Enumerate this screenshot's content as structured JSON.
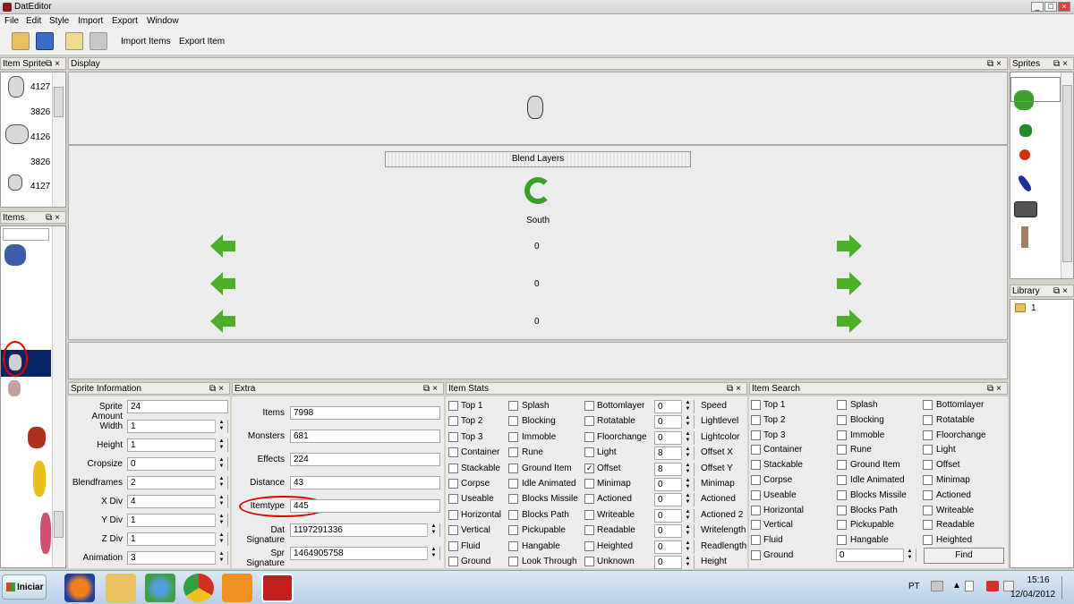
{
  "window": {
    "title": "DatEditor"
  },
  "menu": [
    "File",
    "Edit",
    "Style",
    "Import",
    "Export",
    "Window"
  ],
  "toolbar": {
    "import_items": "Import Items",
    "export_item": "Export Item"
  },
  "item_sprites": {
    "title": "Item Sprite",
    "rows": [
      "4127",
      "3826",
      "4126",
      "3826",
      "4127"
    ]
  },
  "items": {
    "title": "Items"
  },
  "display": {
    "title": "Display",
    "blend_layers": "Blend Layers",
    "direction": "South",
    "rows": [
      "0",
      "0",
      "0"
    ]
  },
  "sprite_info": {
    "title": "Sprite Information",
    "fields": [
      {
        "label": "Sprite Amount",
        "value": "24"
      },
      {
        "label": "Width",
        "value": "1"
      },
      {
        "label": "Height",
        "value": "1"
      },
      {
        "label": "Cropsize",
        "value": "0"
      },
      {
        "label": "Blendframes",
        "value": "2"
      },
      {
        "label": "X Div",
        "value": "4"
      },
      {
        "label": "Y Div",
        "value": "1"
      },
      {
        "label": "Z Div",
        "value": "1"
      },
      {
        "label": "Animation",
        "value": "3"
      }
    ]
  },
  "extra": {
    "title": "Extra",
    "fields": [
      {
        "label": "Items",
        "value": "7998"
      },
      {
        "label": "Monsters",
        "value": "681"
      },
      {
        "label": "Effects",
        "value": "224"
      },
      {
        "label": "Distance",
        "value": "43"
      },
      {
        "label": "Itemtype",
        "value": "445"
      },
      {
        "label": "Dat Signature",
        "value": "1197291336"
      },
      {
        "label": "Spr Signature",
        "value": "1464905758"
      }
    ]
  },
  "item_stats": {
    "title": "Item Stats",
    "col1": [
      "Top 1",
      "Top 2",
      "Top 3",
      "Container",
      "Stackable",
      "Corpse",
      "Useable",
      "Horizontal",
      "Vertical",
      "Fluid",
      "Ground"
    ],
    "col2": [
      "Splash",
      "Blocking",
      "Immoble",
      "Rune",
      "Ground Item",
      "Idle Animated",
      "Blocks Missile",
      "Blocks Path",
      "Pickupable",
      "Hangable",
      "Look Through"
    ],
    "col3": [
      "Bottomlayer",
      "Rotatable",
      "Floorchange",
      "Light",
      "Offset",
      "Minimap",
      "Actioned",
      "Writeable",
      "Readable",
      "Heighted",
      "Unknown"
    ],
    "col3_checked": [
      false,
      false,
      false,
      false,
      true,
      false,
      false,
      false,
      false,
      false,
      false
    ],
    "values": [
      "0",
      "0",
      "0",
      "8",
      "8",
      "0",
      "0",
      "0",
      "0",
      "0",
      "0"
    ],
    "value_labels": [
      "Speed",
      "Lightlevel",
      "Lightcolor",
      "Offset X",
      "Offset Y",
      "Minimap",
      "Actioned",
      "Actioned 2",
      "Writelength",
      "Readlength",
      "Height"
    ]
  },
  "item_search": {
    "title": "Item Search",
    "col1": [
      "Top 1",
      "Top 2",
      "Top 3",
      "Container",
      "Stackable",
      "Corpse",
      "Useable",
      "Horizontal",
      "Vertical",
      "Fluid",
      "Ground"
    ],
    "col2": [
      "Splash",
      "Blocking",
      "Immoble",
      "Rune",
      "Ground Item",
      "Idle Animated",
      "Blocks Missile",
      "Blocks Path",
      "Pickupable",
      "Hangable"
    ],
    "col3": [
      "Bottomlayer",
      "Rotatable",
      "Floorchange",
      "Light",
      "Offset",
      "Minimap",
      "Actioned",
      "Writeable",
      "Readable",
      "Heighted"
    ],
    "value": "0",
    "find": "Find"
  },
  "sprites": {
    "title": "Sprites"
  },
  "library": {
    "title": "Library",
    "item": "1"
  },
  "taskbar": {
    "start": "Iniciar",
    "lang": "PT",
    "time": "15:16",
    "date": "12/04/2012"
  },
  "colors": {
    "arrow": "#4caf2a",
    "selection": "#0a246a",
    "highlight": "#e00000"
  }
}
